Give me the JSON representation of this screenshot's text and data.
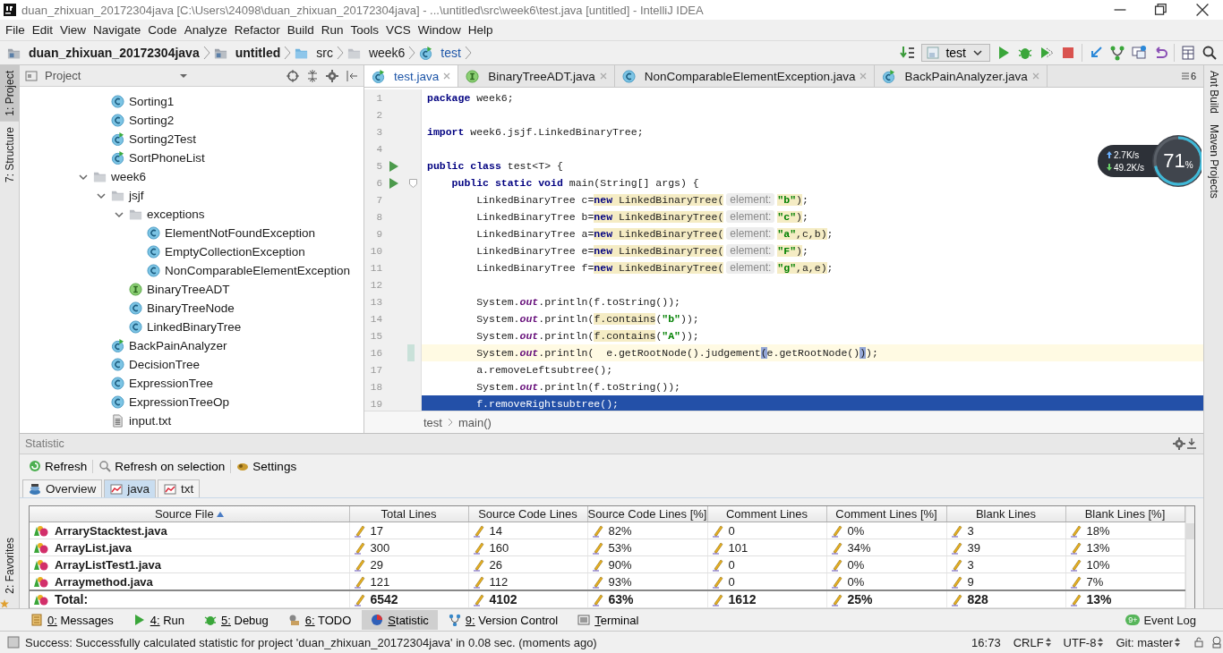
{
  "window": {
    "title": "duan_zhixuan_20172304java [C:\\Users\\24098\\duan_zhixuan_20172304java] - ...\\untitled\\src\\week6\\test.java [untitled] - IntelliJ IDEA"
  },
  "menu": [
    "File",
    "Edit",
    "View",
    "Navigate",
    "Code",
    "Analyze",
    "Refactor",
    "Build",
    "Run",
    "Tools",
    "VCS",
    "Window",
    "Help"
  ],
  "breadcrumbs": [
    {
      "label": "duan_zhixuan_20172304java",
      "kind": "module"
    },
    {
      "label": "untitled",
      "kind": "module"
    },
    {
      "label": "src",
      "kind": "source-folder"
    },
    {
      "label": "week6",
      "kind": "folder"
    },
    {
      "label": "test",
      "kind": "class-run"
    }
  ],
  "run_config": {
    "label": "test"
  },
  "project_panel": {
    "title": "Project",
    "continued_items": [
      {
        "label": "Sorting1",
        "kind": "class"
      },
      {
        "label": "Sorting2",
        "kind": "class"
      },
      {
        "label": "Sorting2Test",
        "kind": "class-run"
      },
      {
        "label": "SortPhoneList",
        "kind": "class-run"
      }
    ],
    "items": [
      {
        "label": "week6",
        "kind": "folder",
        "expanded": true,
        "children": [
          {
            "label": "jsjf",
            "kind": "folder",
            "expanded": true,
            "children": [
              {
                "label": "exceptions",
                "kind": "folder",
                "expanded": true,
                "children": [
                  {
                    "label": "ElementNotFoundException",
                    "kind": "class"
                  },
                  {
                    "label": "EmptyCollectionException",
                    "kind": "class"
                  },
                  {
                    "label": "NonComparableElementException",
                    "kind": "class"
                  }
                ]
              },
              {
                "label": "BinaryTreeADT",
                "kind": "interface"
              },
              {
                "label": "BinaryTreeNode",
                "kind": "class"
              },
              {
                "label": "LinkedBinaryTree",
                "kind": "class"
              }
            ]
          },
          {
            "label": "BackPainAnalyzer",
            "kind": "class-run"
          },
          {
            "label": "DecisionTree",
            "kind": "class"
          },
          {
            "label": "ExpressionTree",
            "kind": "class"
          },
          {
            "label": "ExpressionTreeOp",
            "kind": "class"
          },
          {
            "label": "input.txt",
            "kind": "text-file"
          }
        ]
      }
    ]
  },
  "editor": {
    "tabs": [
      {
        "label": "test.java",
        "kind": "class-run",
        "selected": true
      },
      {
        "label": "BinaryTreeADT.java",
        "kind": "interface",
        "selected": false
      },
      {
        "label": "NonComparableElementException.java",
        "kind": "class",
        "selected": false
      },
      {
        "label": "BackPainAnalyzer.java",
        "kind": "class-run",
        "selected": false
      }
    ],
    "tab_overflow": "6",
    "lines": [
      {
        "number": "1",
        "run_marker": false,
        "caret_line": false,
        "selected": false,
        "tokens": [
          {
            "kind": "keyword",
            "text": "package"
          },
          {
            "kind": "plain",
            "text": " week6;"
          }
        ]
      },
      {
        "number": "2",
        "run_marker": false,
        "caret_line": false,
        "selected": false
      },
      {
        "number": "3",
        "run_marker": false,
        "caret_line": false,
        "selected": false,
        "tokens": [
          {
            "kind": "keyword",
            "text": "import"
          },
          {
            "kind": "plain",
            "text": " week6.jsjf.LinkedBinaryTree;"
          }
        ]
      },
      {
        "number": "4",
        "run_marker": false,
        "caret_line": false,
        "selected": false
      },
      {
        "number": "5",
        "run_marker": true,
        "caret_line": false,
        "selected": false,
        "tokens": [
          {
            "kind": "keyword",
            "text": "public class"
          },
          {
            "kind": "plain",
            "text": " test<T> {"
          }
        ]
      },
      {
        "number": "6",
        "run_marker": true,
        "fold_marker": true,
        "caret_line": false,
        "selected": false,
        "tokens": [
          {
            "kind": "keyword",
            "text": "    public static void"
          },
          {
            "kind": "plain",
            "text": " main(String[] args) {"
          }
        ]
      },
      {
        "number": "7",
        "run_marker": false,
        "caret_line": false,
        "selected": false,
        "tokens": [
          {
            "kind": "plain",
            "text": "        LinkedBinaryTree c="
          },
          {
            "kind": "keyword-hl",
            "text": "new"
          },
          {
            "kind": "plain-hl",
            "text": " LinkedBinaryTree("
          },
          {
            "kind": "hint",
            "text": "element:"
          },
          {
            "kind": "string-hl",
            "text": "\"b\""
          },
          {
            "kind": "plain-hl",
            "text": ")"
          },
          {
            "kind": "plain",
            "text": ";"
          }
        ]
      },
      {
        "number": "8",
        "run_marker": false,
        "caret_line": false,
        "selected": false,
        "tokens": [
          {
            "kind": "plain",
            "text": "        LinkedBinaryTree b="
          },
          {
            "kind": "keyword-hl",
            "text": "new"
          },
          {
            "kind": "plain-hl",
            "text": " LinkedBinaryTree("
          },
          {
            "kind": "hint",
            "text": "element:"
          },
          {
            "kind": "string-hl",
            "text": "\"c\""
          },
          {
            "kind": "plain-hl",
            "text": ")"
          },
          {
            "kind": "plain",
            "text": ";"
          }
        ]
      },
      {
        "number": "9",
        "run_marker": false,
        "caret_line": false,
        "selected": false,
        "tokens": [
          {
            "kind": "plain",
            "text": "        LinkedBinaryTree a="
          },
          {
            "kind": "keyword-hl",
            "text": "new"
          },
          {
            "kind": "plain-hl",
            "text": " LinkedBinaryTree("
          },
          {
            "kind": "hint",
            "text": "element:"
          },
          {
            "kind": "string-hl",
            "text": "\"a\""
          },
          {
            "kind": "plain-hl",
            "text": ",c,b)"
          },
          {
            "kind": "plain",
            "text": ";"
          }
        ]
      },
      {
        "number": "10",
        "run_marker": false,
        "caret_line": false,
        "selected": false,
        "tokens": [
          {
            "kind": "plain",
            "text": "        LinkedBinaryTree e="
          },
          {
            "kind": "keyword-hl",
            "text": "new"
          },
          {
            "kind": "plain-hl",
            "text": " LinkedBinaryTree("
          },
          {
            "kind": "hint",
            "text": "element:"
          },
          {
            "kind": "string-hl",
            "text": "\"F\""
          },
          {
            "kind": "plain-hl",
            "text": ")"
          },
          {
            "kind": "plain",
            "text": ";"
          }
        ]
      },
      {
        "number": "11",
        "run_marker": false,
        "caret_line": false,
        "selected": false,
        "tokens": [
          {
            "kind": "plain",
            "text": "        LinkedBinaryTree f="
          },
          {
            "kind": "keyword-hl",
            "text": "new"
          },
          {
            "kind": "plain-hl",
            "text": " LinkedBinaryTree("
          },
          {
            "kind": "hint",
            "text": "element:"
          },
          {
            "kind": "string-hl",
            "text": "\"g\""
          },
          {
            "kind": "plain-hl",
            "text": ",a,e)"
          },
          {
            "kind": "plain",
            "text": ";"
          }
        ]
      },
      {
        "number": "12",
        "run_marker": false,
        "caret_line": false,
        "selected": false
      },
      {
        "number": "13",
        "run_marker": false,
        "caret_line": false,
        "selected": false,
        "tokens": [
          {
            "kind": "plain",
            "text": "        System."
          },
          {
            "kind": "field",
            "text": "out"
          },
          {
            "kind": "plain",
            "text": ".println(f.toString());"
          }
        ]
      },
      {
        "number": "14",
        "run_marker": false,
        "caret_line": false,
        "selected": false,
        "tokens": [
          {
            "kind": "plain",
            "text": "        System."
          },
          {
            "kind": "field",
            "text": "out"
          },
          {
            "kind": "plain",
            "text": ".println("
          },
          {
            "kind": "plain-hl",
            "text": "f.contains"
          },
          {
            "kind": "plain",
            "text": "("
          },
          {
            "kind": "string",
            "text": "\"b\""
          },
          {
            "kind": "plain",
            "text": "));"
          }
        ]
      },
      {
        "number": "15",
        "run_marker": false,
        "caret_line": false,
        "selected": false,
        "tokens": [
          {
            "kind": "plain",
            "text": "        System."
          },
          {
            "kind": "field",
            "text": "out"
          },
          {
            "kind": "plain",
            "text": ".println("
          },
          {
            "kind": "plain-hl",
            "text": "f.contains"
          },
          {
            "kind": "plain",
            "text": "("
          },
          {
            "kind": "string",
            "text": "\"A\""
          },
          {
            "kind": "plain",
            "text": "));"
          }
        ]
      },
      {
        "number": "16",
        "run_marker": false,
        "changed": true,
        "caret_line": true,
        "selected": false,
        "tokens": [
          {
            "kind": "plain",
            "text": "        System."
          },
          {
            "kind": "field",
            "text": "out"
          },
          {
            "kind": "plain",
            "text": ".println(  e.getRootNode().judgement"
          },
          {
            "kind": "brace-match",
            "text": "("
          },
          {
            "kind": "plain",
            "text": "e.getRootNode()"
          },
          {
            "kind": "brace-match",
            "text": ")"
          },
          {
            "kind": "plain",
            "text": ");"
          }
        ]
      },
      {
        "number": "17",
        "run_marker": false,
        "caret_line": false,
        "selected": false,
        "tokens": [
          {
            "kind": "plain",
            "text": "        a.removeLeftsubtree();"
          }
        ]
      },
      {
        "number": "18",
        "run_marker": false,
        "caret_line": false,
        "selected": false,
        "tokens": [
          {
            "kind": "plain",
            "text": "        System."
          },
          {
            "kind": "field",
            "text": "out"
          },
          {
            "kind": "plain",
            "text": ".println(f.toString());"
          }
        ]
      },
      {
        "number": "19",
        "run_marker": false,
        "caret_line": false,
        "selected": true,
        "tokens": [
          {
            "kind": "plain",
            "text": "        f.removeRightsubtree();"
          }
        ]
      }
    ],
    "breadcrumb": [
      "test",
      "main()"
    ]
  },
  "side_tools": {
    "left": [
      {
        "label": "1: Project",
        "selected": true
      },
      {
        "label": "7: Structure",
        "selected": false
      }
    ],
    "left_bottom": [
      {
        "label": "2: Favorites",
        "selected": false
      }
    ],
    "right": [
      {
        "label": "Ant Build"
      },
      {
        "label": "Maven Projects"
      }
    ]
  },
  "network_widget": {
    "upload": "2.7K/s",
    "download": "49.2K/s",
    "percent": "71",
    "unit": "%",
    "level": 0.71
  },
  "statistic": {
    "title": "Statistic",
    "actions": [
      {
        "label": "Refresh",
        "kind": "refresh"
      },
      {
        "label": "Refresh on selection",
        "kind": "search"
      },
      {
        "label": "Settings",
        "kind": "settings"
      }
    ],
    "tabs": [
      {
        "label": "Overview",
        "selected": false
      },
      {
        "label": "java",
        "selected": true
      },
      {
        "label": "txt",
        "selected": false
      }
    ],
    "table": {
      "columns": [
        {
          "label": "Source File",
          "sorted": true
        },
        {
          "label": "Total Lines",
          "sorted": false
        },
        {
          "label": "Source Code Lines",
          "sorted": false
        },
        {
          "label": "Source Code Lines [%]",
          "sorted": false
        },
        {
          "label": "Comment Lines",
          "sorted": false
        },
        {
          "label": "Comment Lines [%]",
          "sorted": false
        },
        {
          "label": "Blank Lines",
          "sorted": false
        },
        {
          "label": "Blank Lines [%]",
          "sorted": false
        }
      ],
      "rows": [
        {
          "file": "ArraryStacktest.java",
          "values": [
            "17",
            "14",
            "82%",
            "0",
            "0%",
            "3",
            "18%"
          ]
        },
        {
          "file": "ArrayList.java",
          "values": [
            "300",
            "160",
            "53%",
            "101",
            "34%",
            "39",
            "13%"
          ]
        },
        {
          "file": "ArrayListTest1.java",
          "values": [
            "29",
            "26",
            "90%",
            "0",
            "0%",
            "3",
            "10%"
          ]
        },
        {
          "file": "Arraymethod.java",
          "values": [
            "121",
            "112",
            "93%",
            "0",
            "0%",
            "9",
            "7%"
          ]
        }
      ],
      "total": {
        "file": "Total:",
        "values": [
          "6542",
          "4102",
          "63%",
          "1612",
          "25%",
          "828",
          "13%"
        ]
      }
    }
  },
  "tool_windows": [
    {
      "label": "0: Messages",
      "kind": "messages",
      "selected": false
    },
    {
      "label": "4: Run",
      "kind": "run",
      "selected": false
    },
    {
      "label": "5: Debug",
      "kind": "debug",
      "selected": false
    },
    {
      "label": "6: TODO",
      "kind": "todo",
      "selected": false
    },
    {
      "label": "Statistic",
      "kind": "statistic",
      "selected": true
    },
    {
      "label": "9: Version Control",
      "kind": "vcs",
      "selected": false
    },
    {
      "label": "Terminal",
      "kind": "terminal",
      "selected": false
    }
  ],
  "event_log": {
    "label": "Event Log",
    "badge": "9+"
  },
  "status_bar": {
    "message": "Success: Successfully calculated statistic for project 'duan_zhixuan_20172304java' in 0.08 sec. (moments ago)",
    "position": "16:73",
    "line_separator": "CRLF",
    "encoding": "UTF-8",
    "vcs": "Git: master"
  }
}
